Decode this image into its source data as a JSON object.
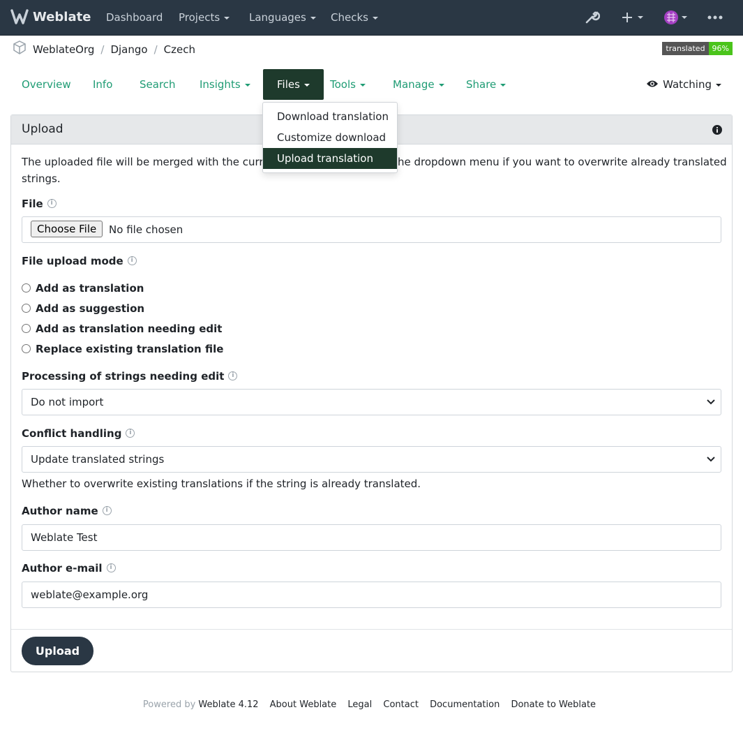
{
  "navbar": {
    "brand": "Weblate",
    "items": [
      {
        "label": "Dashboard"
      },
      {
        "label": "Projects"
      },
      {
        "label": "Languages"
      },
      {
        "label": "Checks"
      }
    ]
  },
  "breadcrumb": {
    "items": [
      "WeblateOrg",
      "Django",
      "Czech"
    ]
  },
  "badge": {
    "label": "translated",
    "value": "96%"
  },
  "tabs": {
    "overview": "Overview",
    "info": "Info",
    "search": "Search",
    "insights": "Insights",
    "files": "Files",
    "tools": "Tools",
    "manage": "Manage",
    "share": "Share",
    "watching": "Watching"
  },
  "files_menu": {
    "items": [
      "Download translation",
      "Customize download",
      "Upload translation"
    ]
  },
  "upload": {
    "title": "Upload",
    "intro_line1": "The uploaded file will be merged with the current t",
    "intro_line1b": "he dropdown menu if you want to overwrite already translated",
    "intro_line2": "strings.",
    "file_label": "File",
    "file_button": "Choose File",
    "file_status": "No file chosen",
    "mode_label": "File upload mode",
    "modes": [
      "Add as translation",
      "Add as suggestion",
      "Add as translation needing edit",
      "Replace existing translation file"
    ],
    "fuzzy_label": "Processing of strings needing edit",
    "fuzzy_value": "Do not import",
    "conflict_label": "Conflict handling",
    "conflict_value": "Update translated strings",
    "conflict_help": "Whether to overwrite existing translations if the string is already translated.",
    "author_name_label": "Author name",
    "author_name_value": "Weblate Test",
    "author_email_label": "Author e-mail",
    "author_email_value": "weblate@example.org",
    "submit": "Upload"
  },
  "footer": {
    "powered_by": "Powered by",
    "version": "Weblate 4.12",
    "links": [
      "About Weblate",
      "Legal",
      "Contact",
      "Documentation",
      "Donate to Weblate"
    ]
  },
  "colors": {
    "navbar": "#2a3744",
    "accent": "#1f9c74",
    "active_tab": "#1e3a2c",
    "badge_green": "#4ac41b"
  }
}
